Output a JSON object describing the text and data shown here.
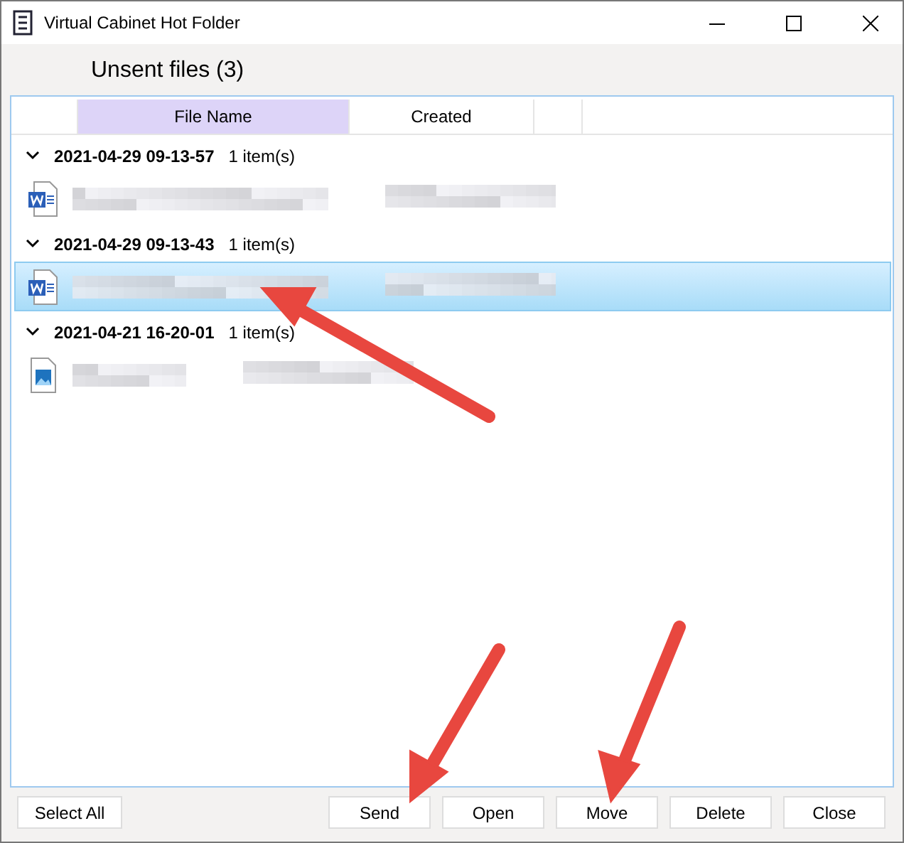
{
  "window": {
    "title": "Virtual Cabinet Hot Folder"
  },
  "heading": "Unsent files (3)",
  "columns": [
    {
      "label": "File Name",
      "selected": true
    },
    {
      "label": "Created",
      "selected": false
    }
  ],
  "groups": [
    {
      "date": "2021-04-29 09-13-57",
      "count": "1 item(s)",
      "items": [
        {
          "kind": "word",
          "selected": false
        }
      ]
    },
    {
      "date": "2021-04-29 09-13-43",
      "count": "1 item(s)",
      "items": [
        {
          "kind": "word",
          "selected": true
        }
      ]
    },
    {
      "date": "2021-04-21 16-20-01",
      "count": "1 item(s)",
      "items": [
        {
          "kind": "image",
          "selected": false
        }
      ]
    }
  ],
  "buttons": [
    "Select All",
    "Send",
    "Open",
    "Move",
    "Delete",
    "Close"
  ]
}
